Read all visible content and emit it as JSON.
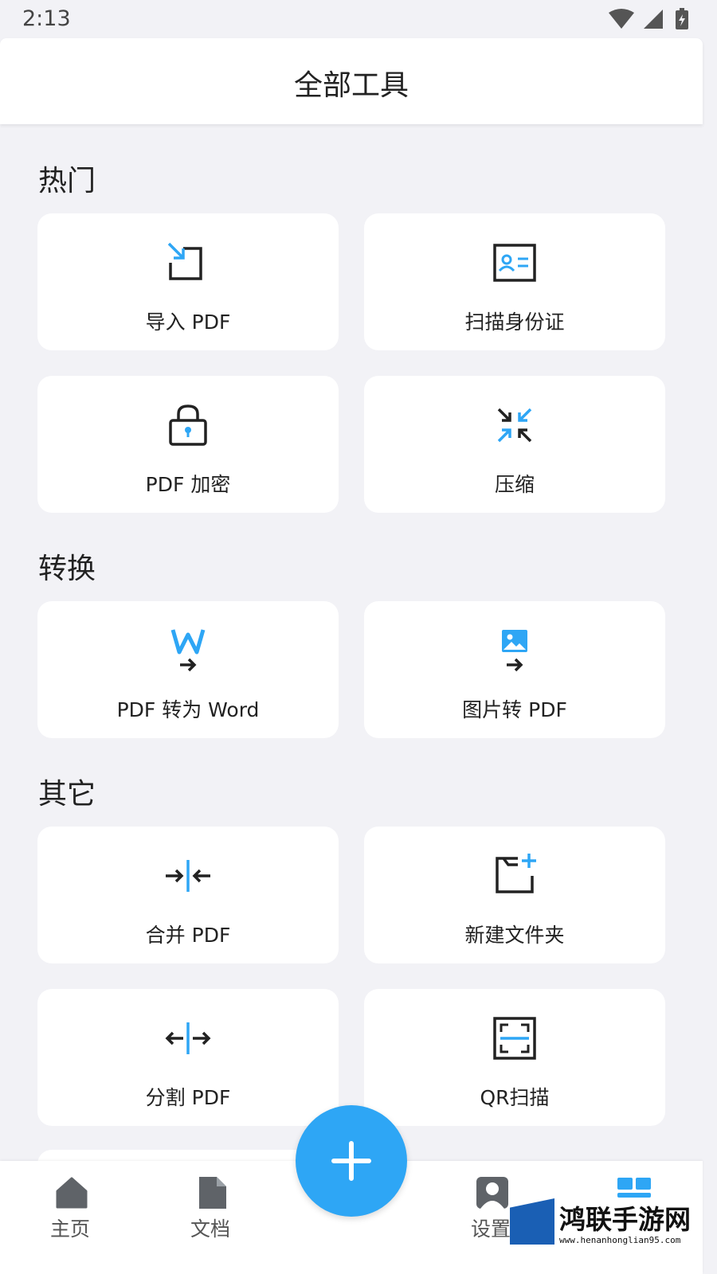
{
  "status_bar": {
    "time": "2:13",
    "icons": [
      "wifi-icon",
      "signal-icon",
      "battery-icon"
    ]
  },
  "header": {
    "title": "全部工具"
  },
  "sections": {
    "hot": {
      "title": "热门",
      "tools": [
        {
          "label": "导入 PDF",
          "icon": "import-icon"
        },
        {
          "label": "扫描身份证",
          "icon": "id-card-icon"
        },
        {
          "label": "PDF 加密",
          "icon": "lock-icon"
        },
        {
          "label": "压缩",
          "icon": "compress-icon"
        }
      ]
    },
    "convert": {
      "title": "转换",
      "tools": [
        {
          "label": "PDF 转为 Word",
          "icon": "word-convert-icon"
        },
        {
          "label": "图片转 PDF",
          "icon": "image-convert-icon"
        }
      ]
    },
    "other": {
      "title": "其它",
      "tools": [
        {
          "label": "合并 PDF",
          "icon": "merge-icon"
        },
        {
          "label": "新建文件夹",
          "icon": "new-folder-icon"
        },
        {
          "label": "分割 PDF",
          "icon": "split-icon"
        },
        {
          "label": "QR扫描",
          "icon": "qr-scan-icon"
        }
      ]
    }
  },
  "bottom_nav": {
    "items": [
      {
        "label": "主页",
        "icon": "home-icon"
      },
      {
        "label": "文档",
        "icon": "document-icon"
      },
      {
        "label": "设置",
        "icon": "profile-icon"
      },
      {
        "label": "",
        "icon": "tools-grid-icon",
        "active": true
      }
    ],
    "fab_icon": "plus-icon"
  },
  "watermark": {
    "text": "鸿联手游网",
    "url": "www.henanhonglian95.com"
  },
  "colors": {
    "accent": "#2ea6f5",
    "background": "#f2f2f6",
    "card": "#ffffff",
    "text": "#222222",
    "nav_icon": "#5f6368"
  }
}
